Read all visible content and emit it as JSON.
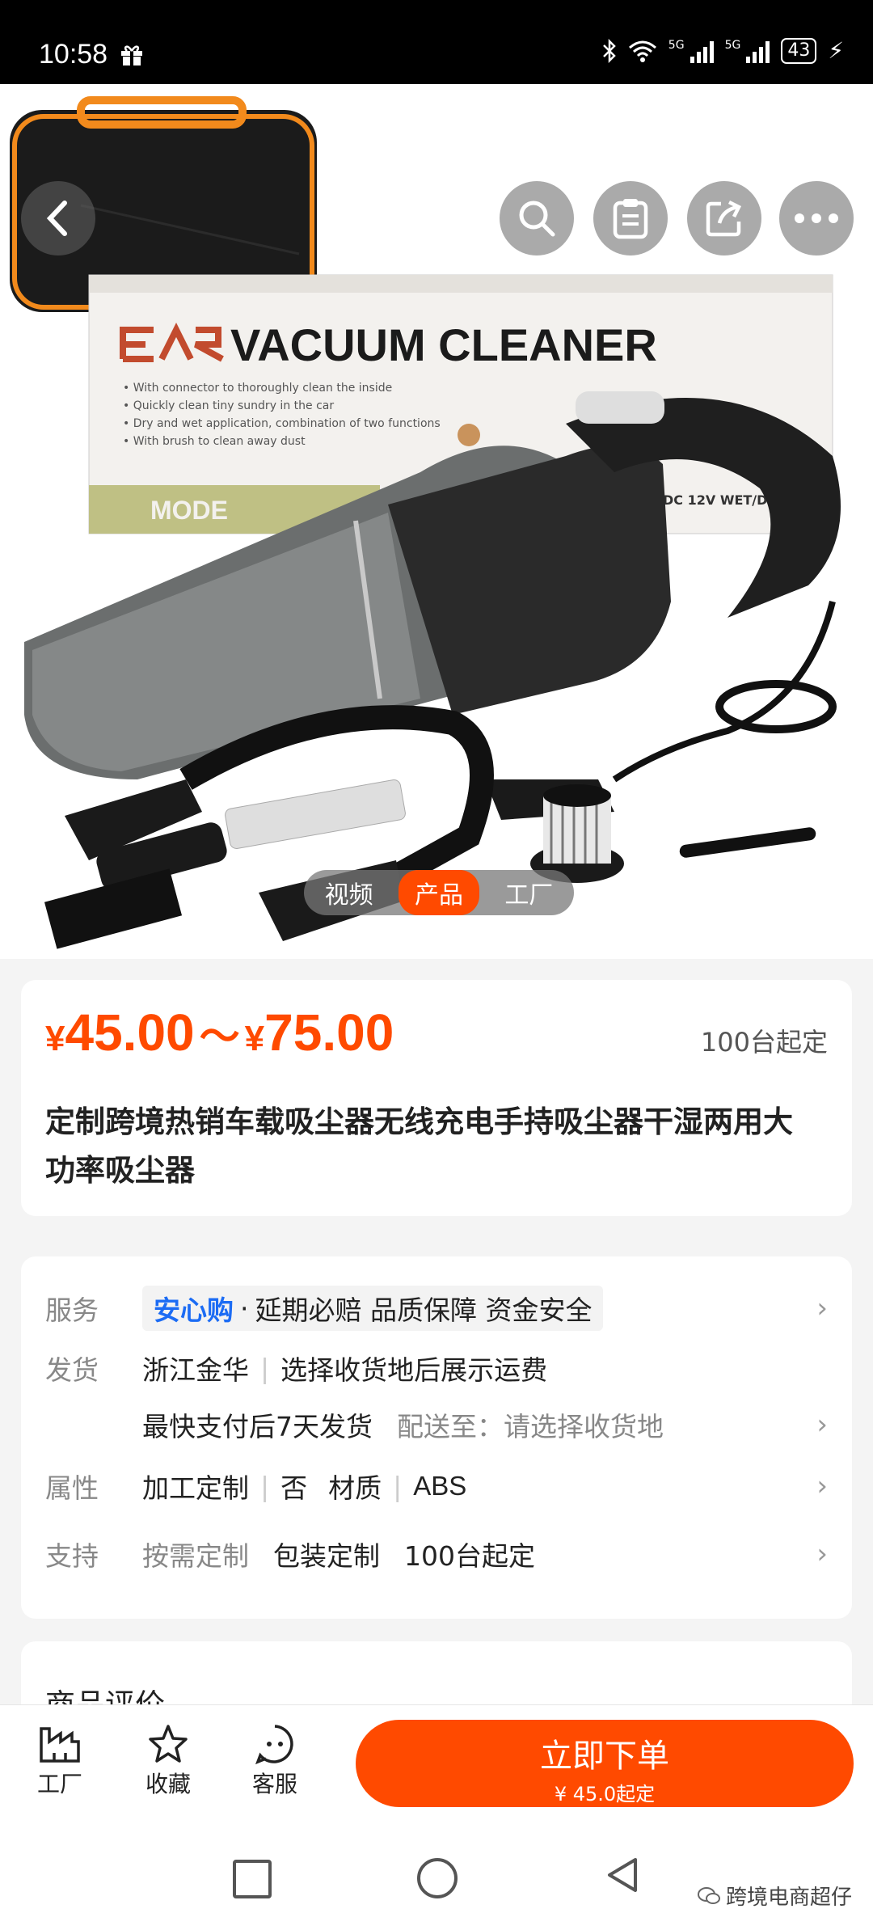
{
  "status_bar": {
    "time": "10:58",
    "battery": "43",
    "net1": "5G",
    "net2": "5G"
  },
  "hero": {
    "box_brand": "VACUUM CLEANER",
    "box_lines": [
      "• With connector to thoroughly clean the inside",
      "• Quickly clean tiny sundry in the car",
      "• Dry and wet application, combination of two functions",
      "• With brush to clean away dust"
    ],
    "box_model": "MODE",
    "box_spec": "DC 12V WET/D",
    "media_tabs": [
      "视频",
      "产品",
      "工厂"
    ],
    "active_tab": 1
  },
  "price": {
    "yen": "¥",
    "low": "45.00",
    "tilde": "～",
    "high": "75.00",
    "moq": "100台起定",
    "title": "定制跨境热销车载吸尘器无线充电手持吸尘器干湿两用大功率吸尘器"
  },
  "info": {
    "service": {
      "key": "服务",
      "brand": "安心购",
      "dot": "·",
      "items": "延期必赔 品质保障 资金安全"
    },
    "shipping": {
      "key": "发货",
      "origin": "浙江金华",
      "freight": "选择收货地后展示运费",
      "time": "最快支付后7天发货",
      "dest": "配送至：请选择收货地"
    },
    "attrs": {
      "key": "属性",
      "a1": "加工定制",
      "a2": "否",
      "a3": "材质",
      "a4": "ABS"
    },
    "support": {
      "key": "支持",
      "s1": "按需定制",
      "s2": "包装定制",
      "s3": "100台起定"
    }
  },
  "review": {
    "title": "商品评价"
  },
  "bottom_bar": {
    "factory": "工厂",
    "favorite": "收藏",
    "service": "客服",
    "order_main": "立即下单",
    "order_sub": "¥ 45.0起定"
  },
  "watermark": "跨境电商超仔",
  "colors": {
    "accent": "#ff4a00",
    "brand_blue": "#1c6cf4"
  }
}
